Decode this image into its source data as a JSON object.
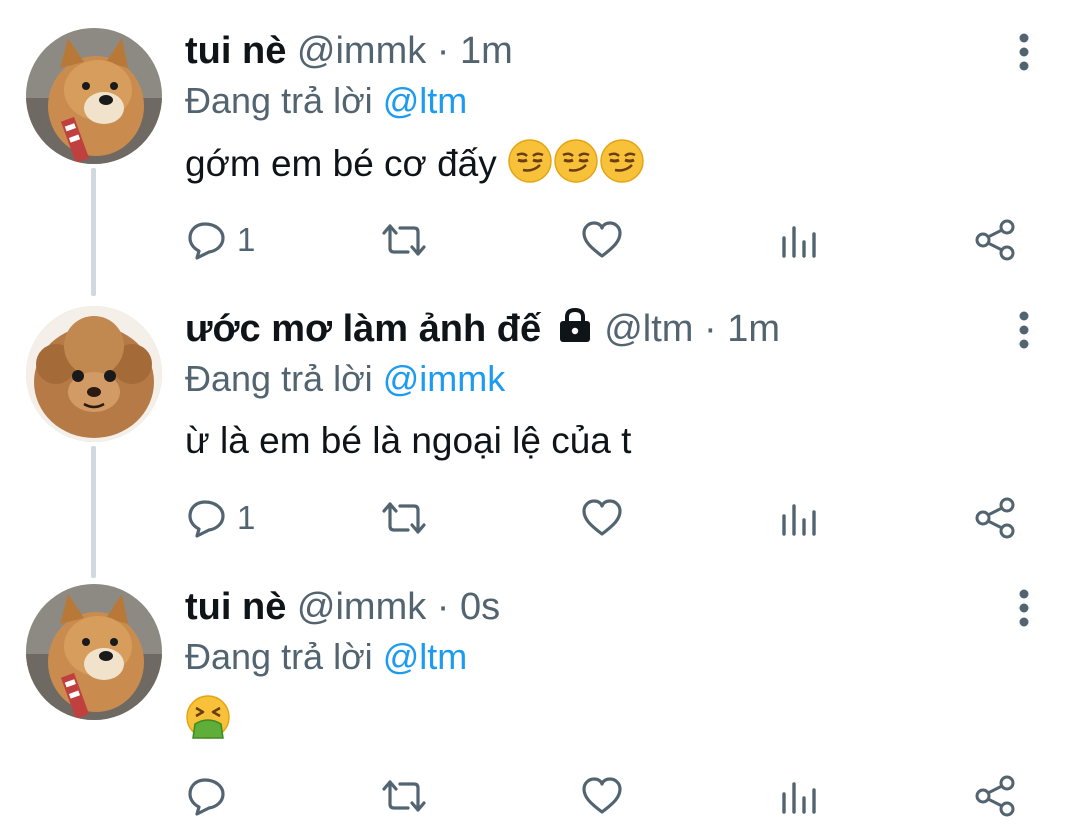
{
  "tweets": [
    {
      "name": "tui nè",
      "handle": "@immk",
      "separator": "·",
      "time": "1m",
      "reply_prefix": "Đang trả lời",
      "reply_to": "@ltm",
      "text": "gớm em bé cơ đấy",
      "emojis": [
        "smirking-face",
        "smirking-face",
        "smirking-face"
      ],
      "replies": "1",
      "avatar": "shiba-dog"
    },
    {
      "name": "ước mơ làm ảnh đế",
      "handle": "@ltm",
      "separator": "·",
      "time": "1m",
      "reply_prefix": "Đang trả lời",
      "reply_to": "@immk",
      "text": "ừ là em bé là ngoại lệ của t",
      "replies": "1",
      "locked": true,
      "avatar": "poodle-dog"
    },
    {
      "name": "tui nè",
      "handle": "@immk",
      "separator": "·",
      "time": "0s",
      "reply_prefix": "Đang trả lời",
      "reply_to": "@ltm",
      "text": "",
      "emojis": [
        "vomiting-face"
      ],
      "replies": "",
      "avatar": "shiba-dog"
    }
  ],
  "colors": {
    "accent": "#1d9bf0",
    "muted": "#536471",
    "text": "#0f1419",
    "thread": "#cfd9de"
  }
}
